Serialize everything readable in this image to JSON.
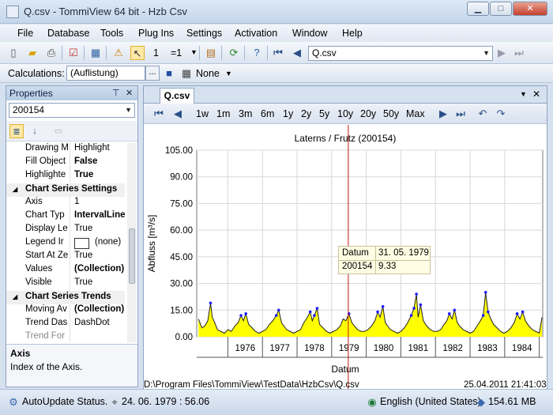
{
  "window": {
    "title": "Q.csv - TommiView 64 bit - Hzb Csv",
    "minimize": "▁",
    "maximize": "□",
    "close": "✕"
  },
  "menu": [
    "File",
    "Database",
    "Tools",
    "Plug Ins",
    "Settings",
    "Activation",
    "Window",
    "Help"
  ],
  "toolbar1": {
    "counter_value": "1",
    "counter_label": "=1",
    "file_combo": "Q.csv"
  },
  "toolbar2": {
    "calc_label": "Calculations:",
    "calc_value": "(Auflistung)",
    "calc_dots": "...",
    "none_label": "None"
  },
  "properties": {
    "title": "Properties",
    "pin": "⊤",
    "close": "✕",
    "object_combo": "200154",
    "rows": [
      {
        "type": "prop",
        "key": "Drawing M",
        "value": "Highlight",
        "bold": false
      },
      {
        "type": "prop",
        "key": "Fill Object",
        "value": "False",
        "bold": true
      },
      {
        "type": "prop",
        "key": "Highlighte",
        "value": "True",
        "bold": true
      },
      {
        "type": "cat",
        "key": "Chart Series Settings"
      },
      {
        "type": "prop",
        "key": "Axis",
        "value": "1",
        "bold": false
      },
      {
        "type": "prop",
        "key": "Chart Typ",
        "value": "IntervalLine",
        "bold": true
      },
      {
        "type": "prop",
        "key": "Display Le",
        "value": "True",
        "bold": false
      },
      {
        "type": "prop",
        "key": "Legend Ir",
        "value": "(none)",
        "bold": false
      },
      {
        "type": "prop",
        "key": "Start At Ze",
        "value": "True",
        "bold": false
      },
      {
        "type": "prop",
        "key": "Values",
        "value": "(Collection)",
        "bold": true
      },
      {
        "type": "prop",
        "key": "Visible",
        "value": "True",
        "bold": false
      },
      {
        "type": "cat",
        "key": "Chart Series Trends"
      },
      {
        "type": "prop",
        "key": "Moving Av",
        "value": "(Collection)",
        "bold": true
      },
      {
        "type": "prop",
        "key": "Trend Das",
        "value": "DashDot",
        "bold": false
      },
      {
        "type": "prop",
        "key": "Trend For",
        "value": "",
        "bold": false
      }
    ],
    "help_title": "Axis",
    "help_text": "Index of the Axis."
  },
  "document": {
    "tab_label": "Q.csv",
    "zoom_buttons": [
      "1w",
      "1m",
      "3m",
      "6m",
      "1y",
      "2y",
      "5y",
      "10y",
      "20y",
      "50y",
      "Max"
    ],
    "file_path": "D:\\Program Files\\TommiView\\TestData\\HzbCsv\\Q.csv",
    "timestamp": "25.04.2011 21:41:03"
  },
  "tooltip": {
    "k1": "Datum",
    "v1": "31. 05. 1979",
    "k2": "200154",
    "v2": "9.33"
  },
  "status": {
    "autoupdate": "AutoUpdate Status.",
    "cursor_date": "24. 06. 1979 : 56.06",
    "language": "English (United States)",
    "memory": "154.61 MB"
  },
  "chart_data": {
    "type": "line",
    "title": "Laterns / Frutz (200154)",
    "xlabel": "Datum",
    "ylabel": "Abfluss  [m³/s]",
    "ylim": [
      0,
      105
    ],
    "yticks": [
      "105.00",
      "90.00",
      "75.00",
      "60.00",
      "45.00",
      "30.00",
      "15.00",
      "0.00"
    ],
    "xticks": [
      "1976",
      "1977",
      "1978",
      "1979",
      "1980",
      "1981",
      "1982",
      "1983",
      "1984"
    ],
    "xlim": [
      1975.1,
      1985.1
    ],
    "cursor_x": 1979.48,
    "series": [
      {
        "name": "200154",
        "x": [
          1975.15,
          1975.25,
          1975.33,
          1975.42,
          1975.5,
          1975.55,
          1975.62,
          1975.7,
          1975.8,
          1975.9,
          1976.0,
          1976.1,
          1976.2,
          1976.3,
          1976.38,
          1976.45,
          1976.52,
          1976.6,
          1976.7,
          1976.8,
          1976.9,
          1977.0,
          1977.1,
          1977.2,
          1977.3,
          1977.4,
          1977.47,
          1977.55,
          1977.62,
          1977.7,
          1977.8,
          1977.9,
          1978.0,
          1978.1,
          1978.2,
          1978.3,
          1978.38,
          1978.44,
          1978.5,
          1978.58,
          1978.65,
          1978.75,
          1978.85,
          1978.95,
          1979.05,
          1979.15,
          1979.25,
          1979.33,
          1979.41,
          1979.5,
          1979.58,
          1979.66,
          1979.75,
          1979.85,
          1979.95,
          1980.05,
          1980.15,
          1980.25,
          1980.33,
          1980.4,
          1980.48,
          1980.55,
          1980.62,
          1980.7,
          1980.8,
          1980.9,
          1981.0,
          1981.1,
          1981.2,
          1981.3,
          1981.38,
          1981.45,
          1981.5,
          1981.57,
          1981.65,
          1981.75,
          1981.85,
          1981.95,
          1982.05,
          1982.15,
          1982.25,
          1982.33,
          1982.4,
          1982.48,
          1982.55,
          1982.63,
          1982.7,
          1982.8,
          1982.9,
          1983.0,
          1983.1,
          1983.2,
          1983.3,
          1983.38,
          1983.45,
          1983.52,
          1983.6,
          1983.68,
          1983.78,
          1983.88,
          1983.98,
          1984.08,
          1984.18,
          1984.28,
          1984.36,
          1984.44,
          1984.52,
          1984.6,
          1984.7,
          1984.8,
          1984.9,
          1985.0,
          1985.08
        ],
        "values": [
          10,
          5,
          6,
          9,
          19,
          11,
          8,
          4,
          3,
          2,
          4,
          3,
          6,
          8,
          12,
          9,
          13,
          7,
          5,
          3,
          2,
          3,
          4,
          7,
          9,
          12,
          15,
          8,
          6,
          4,
          3,
          2,
          3,
          4,
          8,
          11,
          14,
          9,
          12,
          16,
          7,
          5,
          3,
          2,
          3,
          4,
          6,
          10,
          9,
          13,
          8,
          6,
          4,
          3,
          3,
          4,
          6,
          9,
          14,
          11,
          17,
          8,
          6,
          4,
          3,
          2,
          3,
          5,
          8,
          12,
          16,
          24,
          11,
          18,
          9,
          6,
          4,
          3,
          3,
          4,
          7,
          9,
          13,
          10,
          15,
          8,
          6,
          4,
          3,
          2,
          3,
          6,
          9,
          12,
          25,
          14,
          10,
          7,
          5,
          3,
          2,
          3,
          5,
          8,
          13,
          10,
          14,
          9,
          6,
          4,
          3,
          2,
          11
        ]
      }
    ]
  }
}
